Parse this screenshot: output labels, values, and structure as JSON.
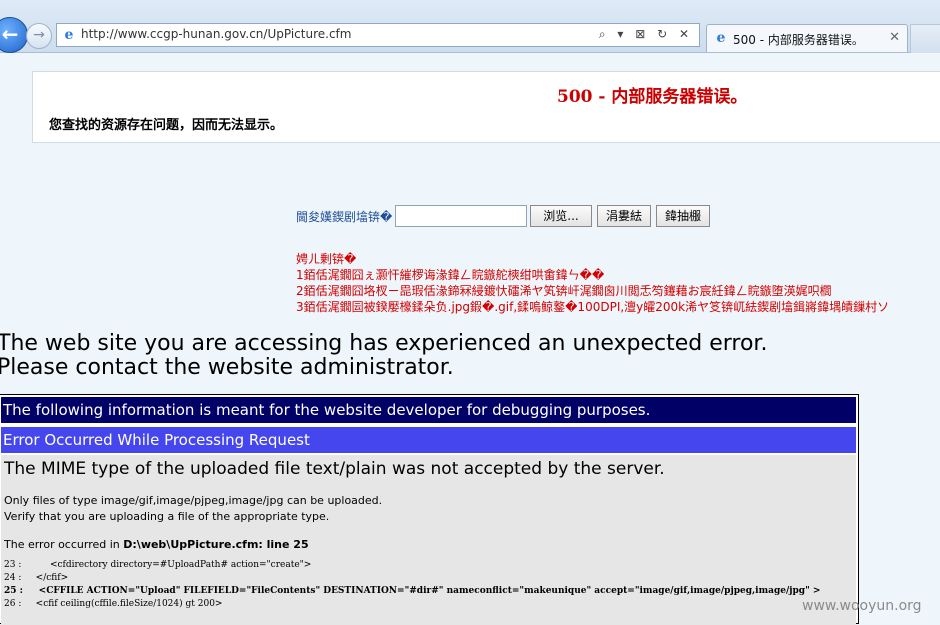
{
  "browser": {
    "url": "http://www.ccgp-hunan.gov.cn/UpPicture.cfm",
    "address_tools": "⌕ ▾ ⊠ ↻ ✕",
    "tab_title": "500 - 内部服务器错误。",
    "tab_close": "✕",
    "back_glyph": "←",
    "forward_glyph": "→",
    "ie_glyph": "e"
  },
  "error500": {
    "title": "500 - 内部服务器错误。",
    "message": "您查找的资源存在问题，因而无法显示。"
  },
  "upload_form": {
    "label": "閫夋嫨鍥剧墖锛�",
    "browse_label": "浏览...",
    "upload_label": "涓婁紶",
    "close_label": "鍏抽棴",
    "notes": [
      "娉ㄦ剰锛�",
      "1銆佸浘鐗囧ぇ灏忓繀椤诲湪鍏ㄥ睆鏃舵樉绀哄畬鍏ㄣ��",
      "2銆佸浘鐗囧垎杈ㄧ巼瑕佸湪鍗冧綅鍍忕礌浠ヤ笂锛屽浘鐗囪川閲忎笉鑳藉お宸紝鍏ㄥ睆鏃堕渶娓呮櫚",
      "3銆佸浘鐗囩被鍨嬮檺鍒朵负.jpg鍜�.gif,鍒嗚鲸鐜�100DPI,澶у皬200k浠ヤ笅锛屼紶鍥剧墖鍓嶈鍏堣皟鏁村ソ"
    ]
  },
  "cf_error": {
    "site_message_1": "The web site you are accessing has experienced an unexpected error.",
    "site_message_2": "Please contact the website administrator.",
    "debug_header": "The following information is meant for the website developer for debugging purposes.",
    "request_header": "Error Occurred While Processing Request",
    "mime_message": "The MIME type of the uploaded file text/plain was not accepted by the server.",
    "allowed_types": "Only files of type image/gif,image/pjpeg,image/jpg can be uploaded.",
    "verify_msg": "Verify that you are uploading a file of the appropriate type.",
    "occurred_prefix": "The error occurred in",
    "occurred_location": "D:\\web\\UpPicture.cfm: line 25",
    "code_lines": [
      "23 :          <cfdirectory directory=#UploadPath# action=\"create\">",
      "24 :     </cfif>",
      "25 :     <CFFILE ACTION=\"Upload\" FILEFIELD=\"FileContents\" DESTINATION=\"#dir#\" nameconflict=\"makeunique\" accept=\"image/gif,image/pjpeg,image/jpg\" >",
      "26 :     <cfif ceiling(cffile.fileSize/1024) gt 200>"
    ]
  },
  "watermark": "www.wooyun.org"
}
